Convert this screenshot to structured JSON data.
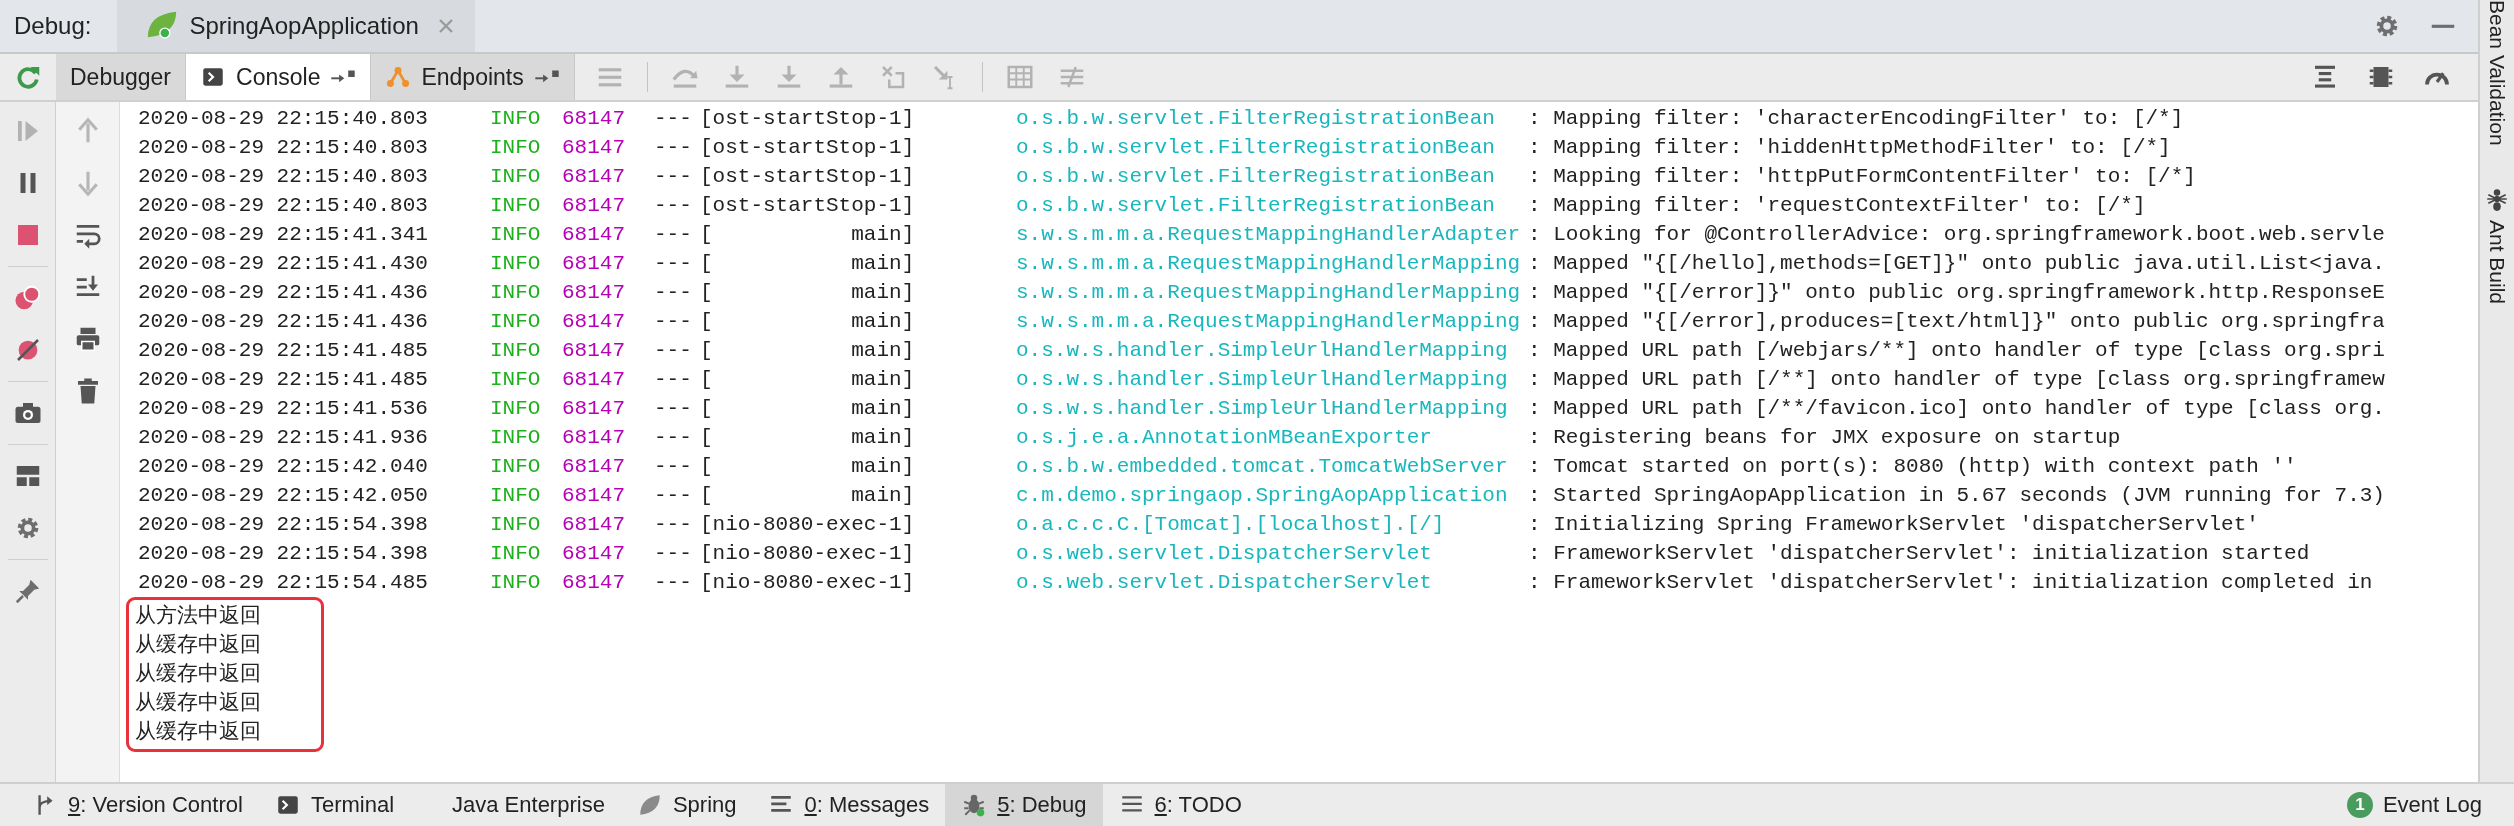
{
  "window": {
    "title_label": "Debug:",
    "tab": {
      "label": "SpringAopApplication",
      "selected": true
    },
    "actions": [
      {
        "kind": "settings"
      },
      {
        "kind": "minimize"
      }
    ]
  },
  "toolbar": {
    "rerun": {
      "kind": "rerun",
      "disabled": false
    },
    "tabs": [
      {
        "label": "Debugger",
        "selected": false,
        "detachable": false,
        "kind": "debugger"
      },
      {
        "label": "Console",
        "selected": true,
        "detachable": true,
        "kind": "console"
      },
      {
        "label": "Endpoints",
        "selected": false,
        "detachable": true,
        "kind": "endpoints"
      }
    ],
    "actions": [
      {
        "kind": "frames",
        "disabled": true
      },
      {
        "kind": "step-over",
        "disabled": true
      },
      {
        "kind": "step-into",
        "disabled": true
      },
      {
        "kind": "force-step-into",
        "disabled": true
      },
      {
        "kind": "step-out",
        "disabled": true
      },
      {
        "kind": "drop-frame",
        "disabled": true
      },
      {
        "kind": "run-to-cursor",
        "disabled": true
      },
      {
        "kind": "evaluate",
        "disabled": true
      },
      {
        "kind": "trace",
        "disabled": true
      }
    ],
    "right_actions": [
      {
        "kind": "layout",
        "disabled": false
      },
      {
        "kind": "memory",
        "disabled": false
      },
      {
        "kind": "gauge",
        "disabled": false
      }
    ]
  },
  "debug_actions": [
    {
      "kind": "resume",
      "disabled": true
    },
    {
      "kind": "pause",
      "disabled": false
    },
    {
      "kind": "stop",
      "disabled": false
    },
    {
      "kind": "breakpoints",
      "disabled": false
    },
    {
      "kind": "mute",
      "disabled": false
    },
    {
      "kind": "camera",
      "disabled": false
    },
    {
      "kind": "layout-grid",
      "disabled": false
    },
    {
      "kind": "settings",
      "disabled": false
    },
    {
      "kind": "pin",
      "disabled": false
    }
  ],
  "console_actions": [
    {
      "kind": "up",
      "disabled": true
    },
    {
      "kind": "down",
      "disabled": true
    },
    {
      "kind": "wrap",
      "disabled": false
    },
    {
      "kind": "scroll-end",
      "disabled": false
    },
    {
      "kind": "print",
      "disabled": false
    },
    {
      "kind": "trash",
      "disabled": false
    }
  ],
  "console": {
    "lines": [
      {
        "kind": "log",
        "date": "2020-08-29 22:15:40.803",
        "level": "INFO",
        "pid": "68147",
        "sep": "---",
        "thread": "[ost-startStop-1]",
        "logger": "o.s.b.w.servlet.FilterRegistrationBean",
        "message": ": Mapping filter: 'characterEncodingFilter' to: [/*]"
      },
      {
        "kind": "log",
        "date": "2020-08-29 22:15:40.803",
        "level": "INFO",
        "pid": "68147",
        "sep": "---",
        "thread": "[ost-startStop-1]",
        "logger": "o.s.b.w.servlet.FilterRegistrationBean",
        "message": ": Mapping filter: 'hiddenHttpMethodFilter' to: [/*]"
      },
      {
        "kind": "log",
        "date": "2020-08-29 22:15:40.803",
        "level": "INFO",
        "pid": "68147",
        "sep": "---",
        "thread": "[ost-startStop-1]",
        "logger": "o.s.b.w.servlet.FilterRegistrationBean",
        "message": ": Mapping filter: 'httpPutFormContentFilter' to: [/*]"
      },
      {
        "kind": "log",
        "date": "2020-08-29 22:15:40.803",
        "level": "INFO",
        "pid": "68147",
        "sep": "---",
        "thread": "[ost-startStop-1]",
        "logger": "o.s.b.w.servlet.FilterRegistrationBean",
        "message": ": Mapping filter: 'requestContextFilter' to: [/*]"
      },
      {
        "kind": "log",
        "date": "2020-08-29 22:15:41.341",
        "level": "INFO",
        "pid": "68147",
        "sep": "---",
        "thread": "[           main]",
        "logger": "s.w.s.m.m.a.RequestMappingHandlerAdapter",
        "message": ": Looking for @ControllerAdvice: org.springframework.boot.web.servle"
      },
      {
        "kind": "log",
        "date": "2020-08-29 22:15:41.430",
        "level": "INFO",
        "pid": "68147",
        "sep": "---",
        "thread": "[           main]",
        "logger": "s.w.s.m.m.a.RequestMappingHandlerMapping",
        "message": ": Mapped \"{[/hello],methods=[GET]}\" onto public java.util.List<java."
      },
      {
        "kind": "log",
        "date": "2020-08-29 22:15:41.436",
        "level": "INFO",
        "pid": "68147",
        "sep": "---",
        "thread": "[           main]",
        "logger": "s.w.s.m.m.a.RequestMappingHandlerMapping",
        "message": ": Mapped \"{[/error]}\" onto public org.springframework.http.ResponseE"
      },
      {
        "kind": "log",
        "date": "2020-08-29 22:15:41.436",
        "level": "INFO",
        "pid": "68147",
        "sep": "---",
        "thread": "[           main]",
        "logger": "s.w.s.m.m.a.RequestMappingHandlerMapping",
        "message": ": Mapped \"{[/error],produces=[text/html]}\" onto public org.springfra"
      },
      {
        "kind": "log",
        "date": "2020-08-29 22:15:41.485",
        "level": "INFO",
        "pid": "68147",
        "sep": "---",
        "thread": "[           main]",
        "logger": "o.s.w.s.handler.SimpleUrlHandlerMapping",
        "message": ": Mapped URL path [/webjars/**] onto handler of type [class org.spri"
      },
      {
        "kind": "log",
        "date": "2020-08-29 22:15:41.485",
        "level": "INFO",
        "pid": "68147",
        "sep": "---",
        "thread": "[           main]",
        "logger": "o.s.w.s.handler.SimpleUrlHandlerMapping",
        "message": ": Mapped URL path [/**] onto handler of type [class org.springframew"
      },
      {
        "kind": "log",
        "date": "2020-08-29 22:15:41.536",
        "level": "INFO",
        "pid": "68147",
        "sep": "---",
        "thread": "[           main]",
        "logger": "o.s.w.s.handler.SimpleUrlHandlerMapping",
        "message": ": Mapped URL path [/**/favicon.ico] onto handler of type [class org."
      },
      {
        "kind": "log",
        "date": "2020-08-29 22:15:41.936",
        "level": "INFO",
        "pid": "68147",
        "sep": "---",
        "thread": "[           main]",
        "logger": "o.s.j.e.a.AnnotationMBeanExporter",
        "message": ": Registering beans for JMX exposure on startup"
      },
      {
        "kind": "log",
        "date": "2020-08-29 22:15:42.040",
        "level": "INFO",
        "pid": "68147",
        "sep": "---",
        "thread": "[           main]",
        "logger": "o.s.b.w.embedded.tomcat.TomcatWebServer",
        "message": ": Tomcat started on port(s): 8080 (http) with context path ''"
      },
      {
        "kind": "log",
        "date": "2020-08-29 22:15:42.050",
        "level": "INFO",
        "pid": "68147",
        "sep": "---",
        "thread": "[           main]",
        "logger": "c.m.demo.springaop.SpringAopApplication",
        "message": ": Started SpringAopApplication in 5.67 seconds (JVM running for 7.3)"
      },
      {
        "kind": "log",
        "date": "2020-08-29 22:15:54.398",
        "level": "INFO",
        "pid": "68147",
        "sep": "---",
        "thread": "[nio-8080-exec-1]",
        "logger": "o.a.c.c.C.[Tomcat].[localhost].[/]",
        "message": ": Initializing Spring FrameworkServlet 'dispatcherServlet'"
      },
      {
        "kind": "log",
        "date": "2020-08-29 22:15:54.398",
        "level": "INFO",
        "pid": "68147",
        "sep": "---",
        "thread": "[nio-8080-exec-1]",
        "logger": "o.s.web.servlet.DispatcherServlet",
        "message": ": FrameworkServlet 'dispatcherServlet': initialization started"
      },
      {
        "kind": "log",
        "date": "2020-08-29 22:15:54.485",
        "level": "INFO",
        "pid": "68147",
        "sep": "---",
        "thread": "[nio-8080-exec-1]",
        "logger": "o.s.web.servlet.DispatcherServlet",
        "message": ": FrameworkServlet 'dispatcherServlet': initialization completed in"
      }
    ],
    "output": {
      "highlighted": true,
      "lines": [
        "从方法中返回",
        "从缓存中返回",
        "从缓存中返回",
        "从缓存中返回",
        "从缓存中返回"
      ]
    }
  },
  "side_panels": [
    {
      "label": "Bean Validation",
      "kind": "bean-validation"
    },
    {
      "label": "Ant Build",
      "kind": "ant-build"
    }
  ],
  "status_bar": {
    "tool_windows": [
      {
        "mnemonic": "9",
        "label": ": Version Control",
        "kind": "version-control",
        "selected": false
      },
      {
        "label": "Terminal",
        "kind": "terminal",
        "selected": false
      },
      {
        "label": "Java Enterprise",
        "kind": "java-enterprise",
        "selected": false
      },
      {
        "label": "Spring",
        "kind": "spring",
        "selected": false
      },
      {
        "mnemonic": "0",
        "label": ": Messages",
        "kind": "messages",
        "selected": false
      },
      {
        "mnemonic": "5",
        "label": ": Debug",
        "kind": "debug",
        "selected": true
      },
      {
        "mnemonic": "6",
        "label": ": TODO",
        "kind": "todo",
        "selected": false
      }
    ],
    "event_log": {
      "label": "Event Log",
      "badge": "1"
    }
  }
}
